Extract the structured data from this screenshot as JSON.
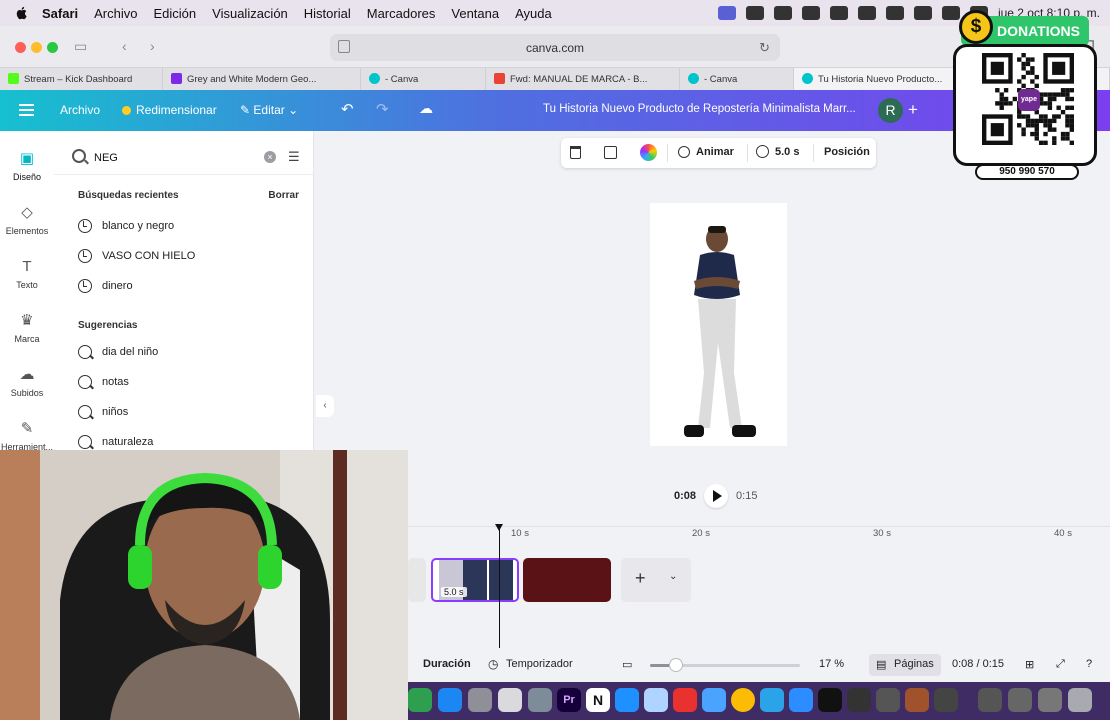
{
  "menubar": {
    "app": "Safari",
    "items": [
      "Archivo",
      "Edición",
      "Visualización",
      "Historial",
      "Marcadores",
      "Ventana",
      "Ayuda"
    ],
    "clock": "jue 2 oct  8:10 p. m."
  },
  "browser": {
    "url": "canva.com",
    "tabs": [
      {
        "label": "Stream – Kick Dashboard",
        "fav": "#53fc18"
      },
      {
        "label": "Grey and White Modern Geo...",
        "fav": "#7d2ae8"
      },
      {
        "label": "- Canva",
        "fav": "#00c4cc"
      },
      {
        "label": "Fwd: MANUAL DE MARCA - B...",
        "fav": "#ea4335"
      },
      {
        "label": "- Canva",
        "fav": "#00c4cc"
      },
      {
        "label": "Tu Historia Nuevo Producto...",
        "fav": "#00c4cc"
      }
    ]
  },
  "canva_header": {
    "archivo": "Archivo",
    "redimensionar": "Redimensionar",
    "editar": "Editar",
    "title": "Tu Historia Nuevo Producto de Repostería Minimalista Marr...",
    "avatar": "R"
  },
  "rail": [
    {
      "label": "Diseño",
      "icon": "design-icon"
    },
    {
      "label": "Elementos",
      "icon": "elements-icon"
    },
    {
      "label": "Texto",
      "icon": "text-icon"
    },
    {
      "label": "Marca",
      "icon": "brand-icon"
    },
    {
      "label": "Subidos",
      "icon": "upload-icon"
    },
    {
      "label": "Herramient...",
      "icon": "tools-icon"
    }
  ],
  "search": {
    "value": "NEG",
    "recent_title": "Búsquedas recientes",
    "clear_label": "Borrar",
    "recent": [
      "blanco y negro",
      "VASO CON HIELO",
      "dinero"
    ],
    "suggest_title": "Sugerencias",
    "suggestions": [
      "dia del niño",
      "notas",
      "niños",
      "naturaleza"
    ]
  },
  "edit_toolbar": {
    "animate": "Animar",
    "duration": "5.0 s",
    "position": "Posición"
  },
  "playback": {
    "current": "0:08",
    "total": "0:15"
  },
  "timeline": {
    "ticks": [
      "10 s",
      "20 s",
      "30 s",
      "40 s"
    ],
    "clip_duration": "5.0 s"
  },
  "footer": {
    "duration": "Duración",
    "timer": "Temporizador",
    "zoom": "17 %",
    "pages": "Páginas",
    "time": "0:08 / 0:15",
    "zoom_fraction": 0.17
  },
  "donations": {
    "title": "DONATIONS",
    "coin": "$",
    "qr_brand": "yape",
    "phone": "950 990 570"
  },
  "colors": {
    "accent": "#8b3dff",
    "header_start": "#16c0cf",
    "header_end": "#7b3ff0"
  }
}
